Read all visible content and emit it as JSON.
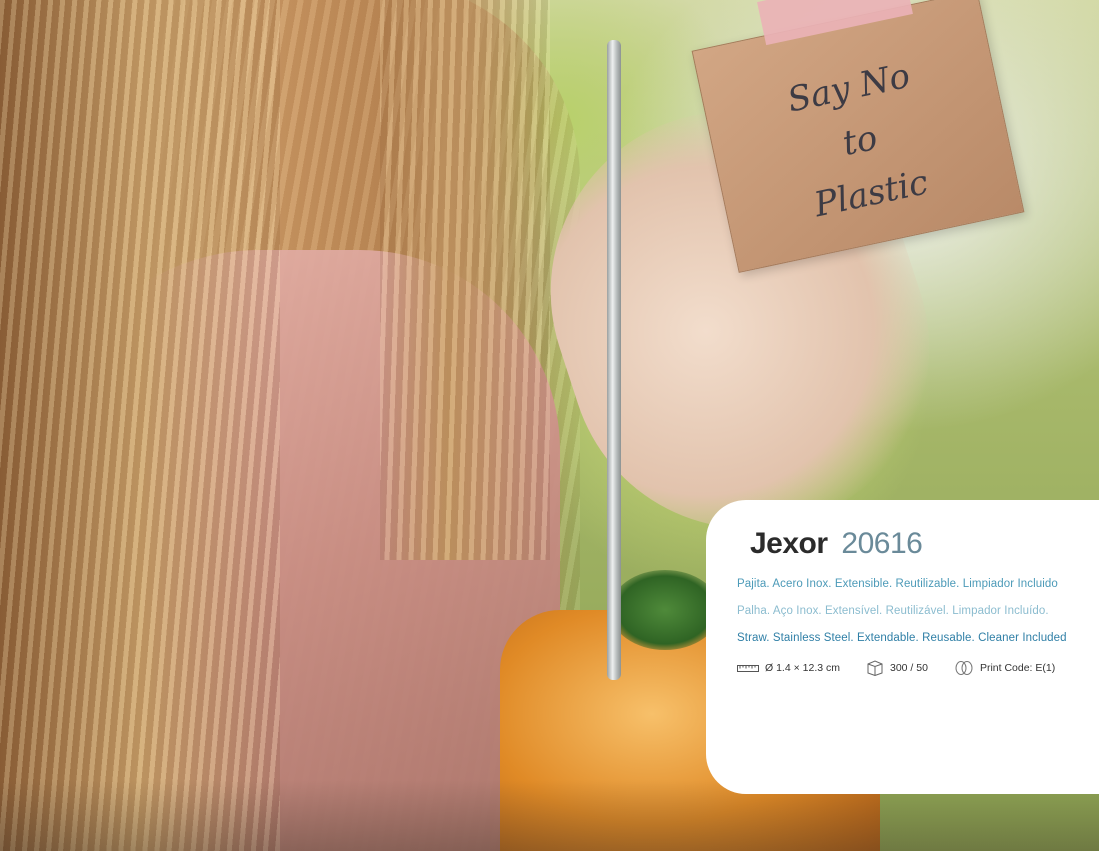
{
  "sign": {
    "lines": [
      "Say No",
      "to",
      "Plastic"
    ]
  },
  "product": {
    "name": "Jexor",
    "code": "20616",
    "desc_es": "Pajita. Acero Inox. Extensible. Reutilizable. Limpiador Incluido",
    "desc_pt": "Palha. Aço Inox. Extensível. Reutilizável. Limpador Incluído.",
    "desc_en": "Straw. Stainless Steel. Extendable. Reusable. Cleaner Included"
  },
  "specs": {
    "dimensions": "Ø 1.4 × 12.3 cm",
    "dimensions_icon": "ruler-icon",
    "packing": "300 / 50",
    "packing_icon": "box-icon",
    "print_code": "Print Code: E(1)",
    "print_code_icon": "print-icon"
  },
  "colors": {
    "title": "#2b2b2b",
    "code": "#6a8a99",
    "desc_es": "#4c9ab8",
    "desc_pt": "#8bbccf",
    "desc_en": "#2f7fa6"
  }
}
